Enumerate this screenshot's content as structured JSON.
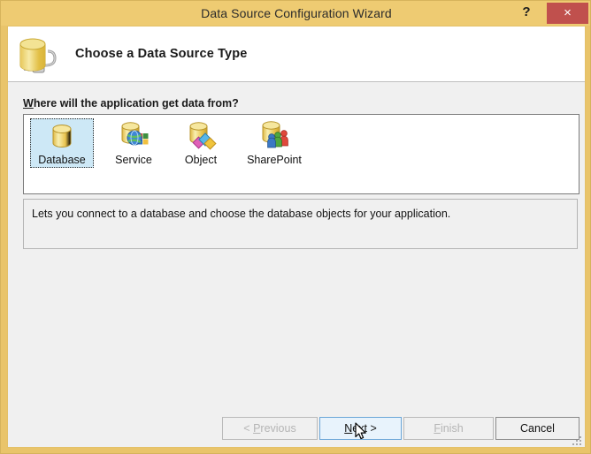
{
  "window": {
    "title": "Data Source Configuration Wizard",
    "help_label": "?",
    "close_label": "×",
    "titlebar_color": "#eecb72",
    "close_color": "#c0504d",
    "frame_color": "#e9c46a"
  },
  "header": {
    "title": "Choose a Data Source Type",
    "icon": "database-plug-icon"
  },
  "body": {
    "prompt_accesskey": "W",
    "prompt_rest": "here will the application get data from?",
    "selected_index": 0,
    "selection_color": "#cde8f6",
    "types": [
      {
        "label": "Database",
        "icon": "database-icon",
        "selected": true
      },
      {
        "label": "Service",
        "icon": "service-globe-icon",
        "selected": false
      },
      {
        "label": "Object",
        "icon": "object-shapes-icon",
        "selected": false
      },
      {
        "label": "SharePoint",
        "icon": "sharepoint-people-icon",
        "selected": false
      }
    ],
    "description": "Lets you connect to a database and choose the database objects for your application."
  },
  "footer": {
    "buttons": [
      {
        "name": "previous",
        "prefix": "< ",
        "accesskey": "P",
        "rest": "revious",
        "suffix": "",
        "state": "disabled"
      },
      {
        "name": "next",
        "prefix": "",
        "accesskey": "N",
        "rest": "ext",
        "suffix": " >",
        "state": "hover"
      },
      {
        "name": "finish",
        "prefix": "",
        "accesskey": "F",
        "rest": "inish",
        "suffix": "",
        "state": "disabled"
      },
      {
        "name": "cancel",
        "prefix": "",
        "accesskey": "",
        "rest": "Cancel",
        "suffix": "",
        "state": "enabled"
      }
    ]
  }
}
